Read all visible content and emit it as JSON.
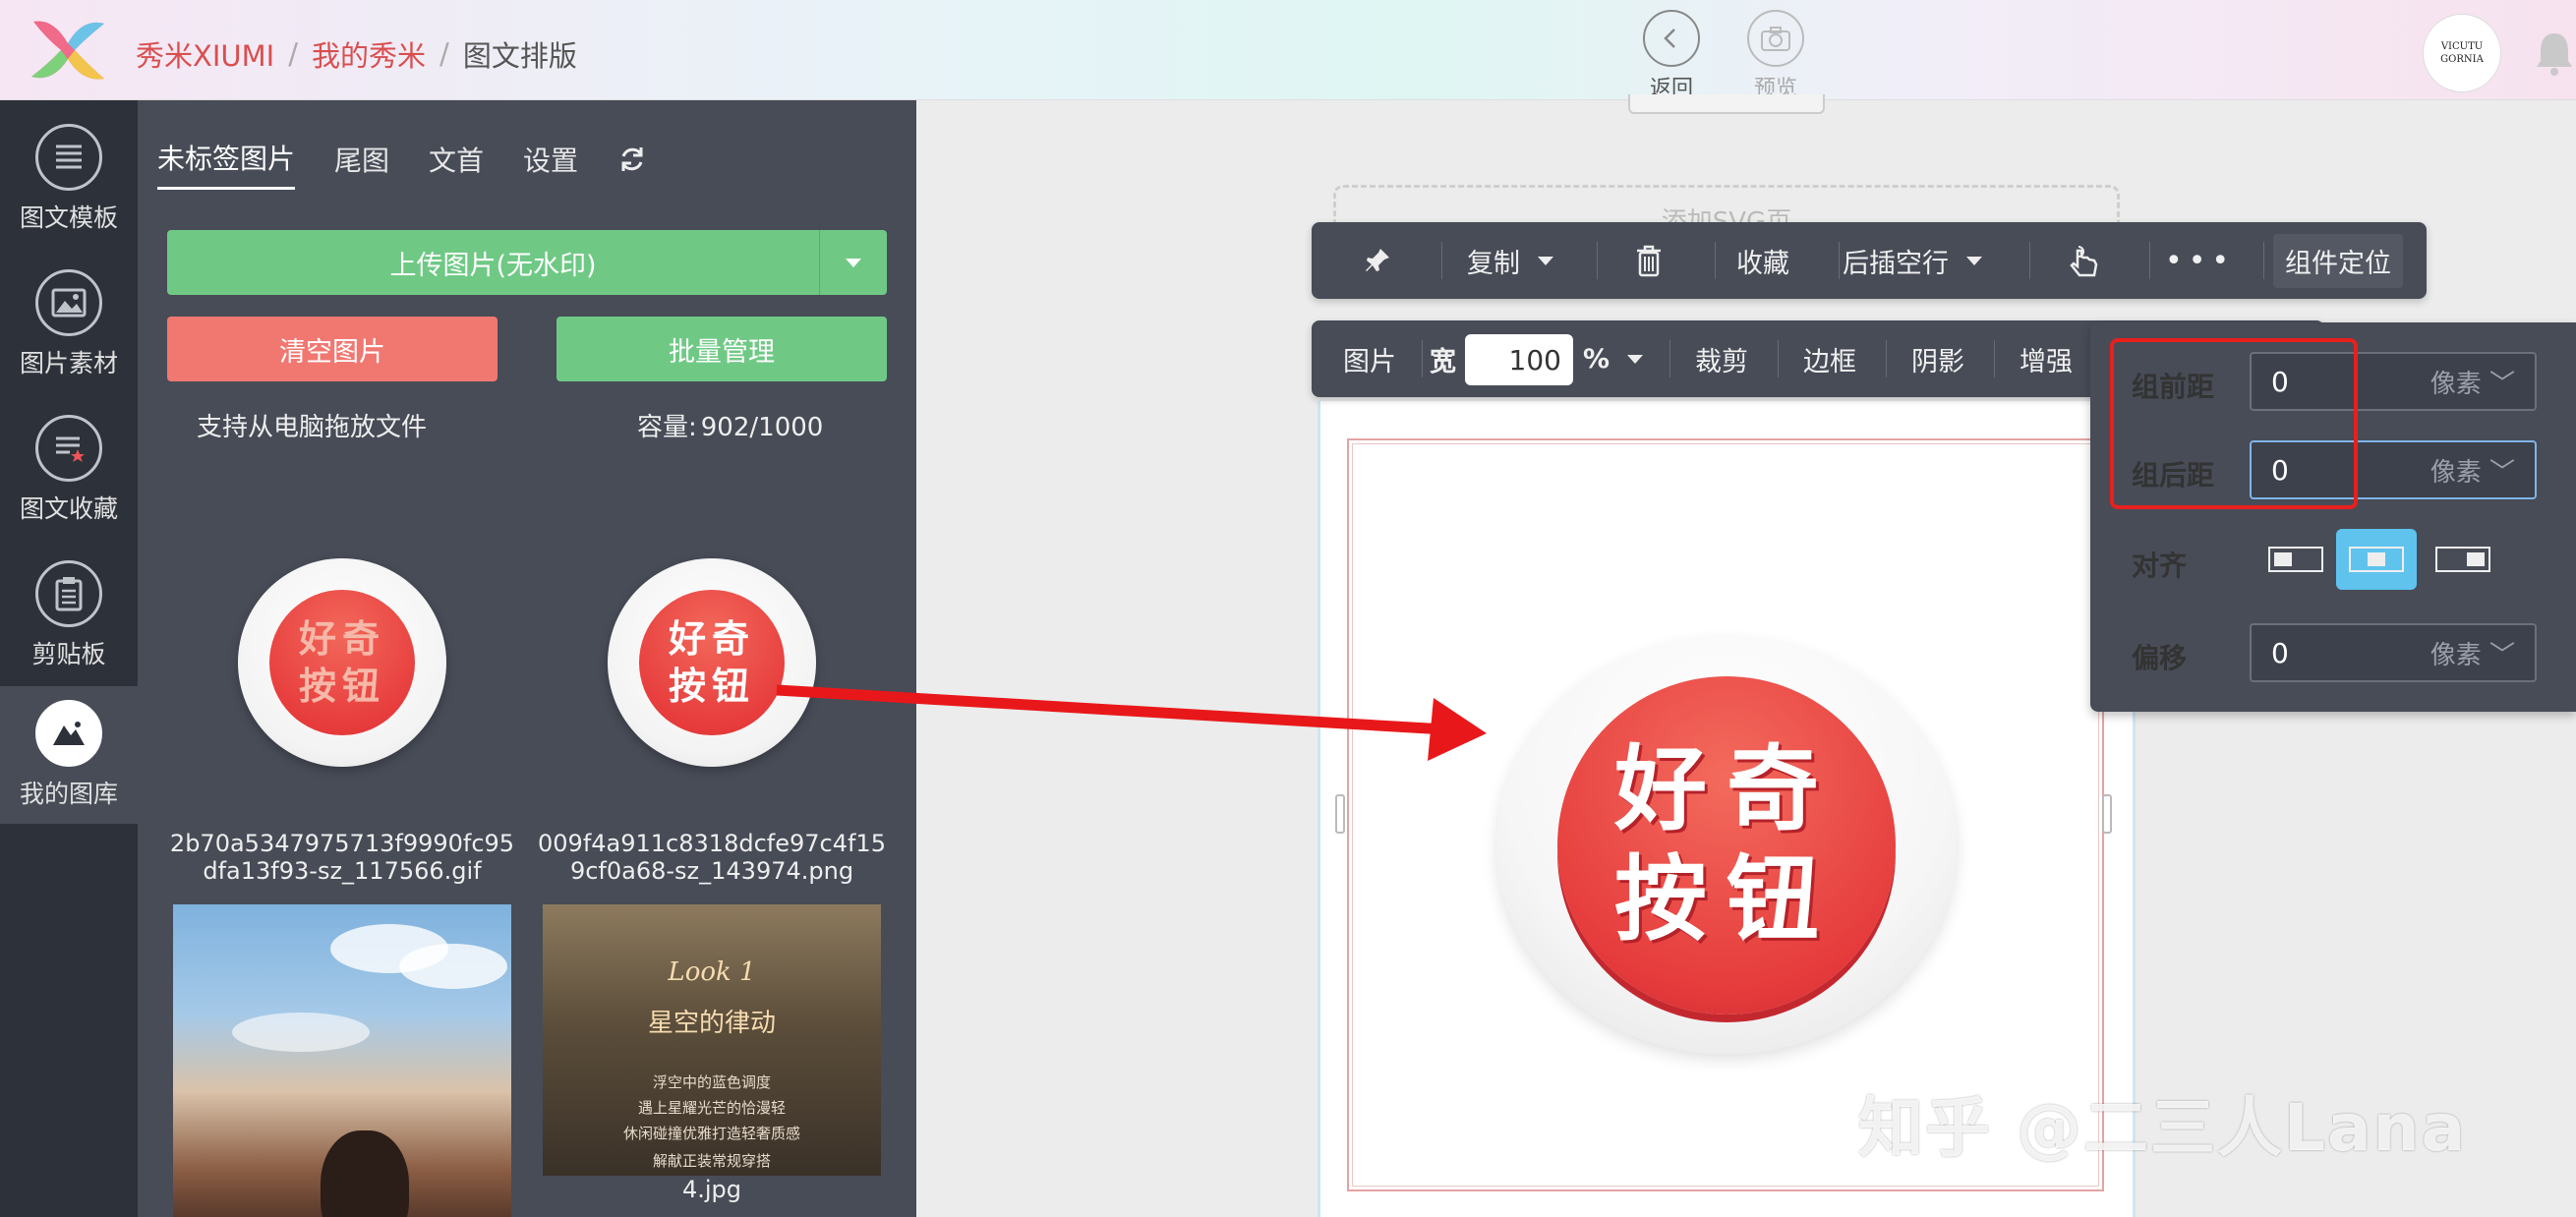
{
  "header": {
    "breadcrumbs": [
      "秀米XIUMI",
      "我的秀米",
      "图文排版"
    ],
    "separator": "/",
    "back_label": "返回",
    "preview_label": "预览",
    "avatar_text": "VICUTU GORNIA"
  },
  "leftnav": {
    "items": [
      {
        "label": "图文模板",
        "icon": "template-icon"
      },
      {
        "label": "图片素材",
        "icon": "image-material-icon"
      },
      {
        "label": "图文收藏",
        "icon": "favorite-icon"
      },
      {
        "label": "剪贴板",
        "icon": "clipboard-icon"
      },
      {
        "label": "我的图库",
        "icon": "gallery-icon",
        "active": true
      }
    ]
  },
  "library": {
    "tabs": [
      "未标签图片",
      "尾图",
      "文首",
      "设置"
    ],
    "active_tab": "未标签图片",
    "upload_label": "上传图片(无水印)",
    "clear_label": "清空图片",
    "batch_label": "批量管理",
    "drag_hint": "支持从电脑拖放文件",
    "capacity_label": "容量:",
    "capacity_value": "902/1000",
    "thumb_text": [
      "好奇",
      "按钮"
    ],
    "files": [
      {
        "name": "2b70a5347975713f9990fc95dfa13f93-sz_117566.gif"
      },
      {
        "name": "009f4a911c8318dcfe97c4f159cf0a68-sz_143974.png"
      },
      {
        "name": ""
      },
      {
        "name": "4.jpg"
      }
    ],
    "photo2_text": {
      "line1": "Look 1",
      "line2": "星空的律动",
      "lines": [
        "浮空中的蓝色调度",
        "遇上星耀光芒的恰漫轻",
        "休闲碰撞优雅打造轻奢质感",
        "解献正装常规穿搭"
      ]
    }
  },
  "toolbar1": {
    "copy_label": "复制",
    "favorite_label": "收藏",
    "insert_line_label": "后插空行",
    "more_label": "•••",
    "locate_label": "组件定位"
  },
  "toolbar2": {
    "image_label": "图片",
    "width_label": "宽",
    "width_value": "100",
    "unit_label": "%",
    "crop_label": "裁剪",
    "border_label": "边框",
    "shadow_label": "阴影",
    "enhance_label": "增强"
  },
  "canvas": {
    "add_svg_label": "添加SVG页",
    "button_text": [
      "好奇",
      "按钮"
    ]
  },
  "spacing_popup": {
    "before_label": "组前距",
    "before_value": "0",
    "after_label": "组后距",
    "after_value": "0",
    "align_label": "对齐",
    "offset_label": "偏移",
    "offset_value": "0",
    "unit": "像素",
    "align_selected": "center"
  },
  "watermark": "知乎 @二三人Lana",
  "colors": {
    "accent_green": "#6fc985",
    "accent_red": "#f07871",
    "panel_bg": "#474c57",
    "nav_bg": "#2d313a",
    "highlight": "#e8201d",
    "align_active": "#5fc3ee"
  }
}
